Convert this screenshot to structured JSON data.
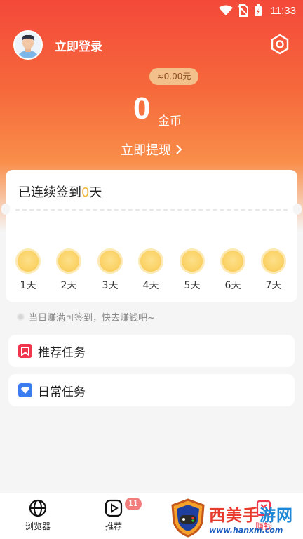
{
  "status_bar": {
    "time": "11:33"
  },
  "header": {
    "login_label": "立即登录",
    "settings_icon": "hexagon-gear-icon",
    "money_pill": "≈0.00元",
    "coin_count": "0",
    "coin_unit": "金币",
    "withdraw_label": "立即提现"
  },
  "signin": {
    "title_prefix": "已连续签到",
    "days": "0",
    "title_suffix": "天",
    "day_labels": [
      "1天",
      "2天",
      "3天",
      "4天",
      "5天",
      "6天",
      "7天"
    ]
  },
  "tip": "当日赚满可签到，快去赚钱吧~",
  "tasks": [
    {
      "label": "推荐任务",
      "icon": "bookmark-icon",
      "color": "#f0364d"
    },
    {
      "label": "日常任务",
      "icon": "diamond-icon",
      "color": "#3b7df0"
    }
  ],
  "bottom_nav": {
    "items": [
      {
        "label": "浏览器",
        "icon": "globe-icon"
      },
      {
        "label": "推荐",
        "icon": "play-icon",
        "badge": "11"
      },
      {
        "label": "赚钱",
        "icon": "wallet-icon"
      }
    ]
  },
  "watermark": {
    "title_red": "西美手",
    "title_blue": "游网",
    "url": "www.hanxm.com"
  }
}
